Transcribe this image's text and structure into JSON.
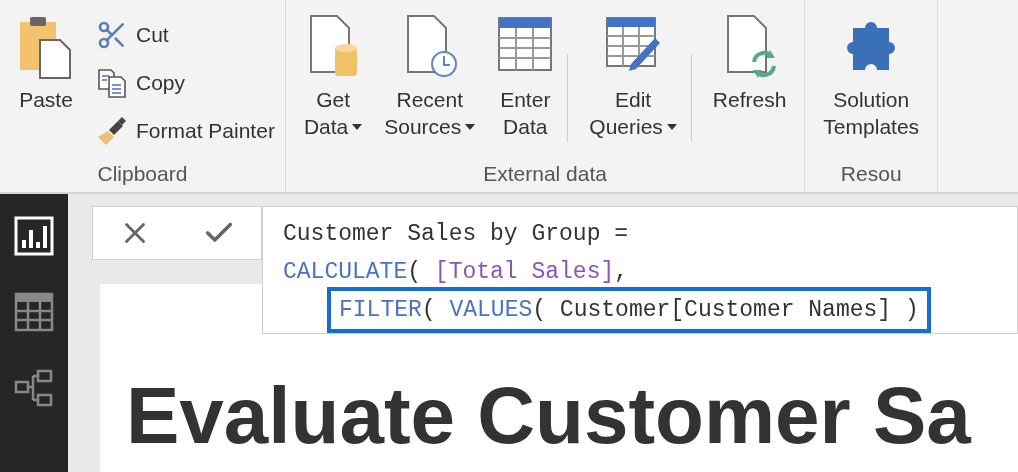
{
  "ribbon": {
    "groups": [
      {
        "label": "Clipboard",
        "large_buttons": [
          {
            "label_lines": [
              "Paste"
            ],
            "dropdown": false,
            "separator_before": false
          }
        ],
        "small_buttons": [
          {
            "label": "Cut"
          },
          {
            "label": "Copy"
          },
          {
            "label": "Format Painter"
          }
        ]
      },
      {
        "label": "External data",
        "large_buttons": [
          {
            "label_lines": [
              "Get",
              "Data"
            ],
            "dropdown": true,
            "separator_before": false
          },
          {
            "label_lines": [
              "Recent",
              "Sources"
            ],
            "dropdown": true,
            "separator_before": false
          },
          {
            "label_lines": [
              "Enter",
              "Data"
            ],
            "dropdown": false,
            "separator_before": false
          },
          {
            "label_lines": [
              "Edit",
              "Queries"
            ],
            "dropdown": true,
            "separator_before": true
          },
          {
            "label_lines": [
              "Refresh"
            ],
            "dropdown": false,
            "separator_before": true
          }
        ]
      },
      {
        "label": "Resou",
        "large_buttons": [
          {
            "label_lines": [
              "Solution",
              "Templates"
            ],
            "dropdown": false,
            "separator_before": false
          }
        ]
      }
    ]
  },
  "sidebar": {
    "views": [
      {
        "selected": true
      },
      {
        "selected": false
      },
      {
        "selected": false
      }
    ]
  },
  "formula_bar": {
    "lines": [
      {
        "boxed": false,
        "tokens": [
          {
            "kind": "plain",
            "text": "Customer Sales by Group ="
          }
        ]
      },
      {
        "boxed": false,
        "tokens": [
          {
            "kind": "keyword",
            "text": "CALCULATE"
          },
          {
            "kind": "plain",
            "text": "( "
          },
          {
            "kind": "measure",
            "text": "[Total Sales]"
          },
          {
            "kind": "plain",
            "text": ","
          }
        ]
      },
      {
        "boxed": true,
        "tokens": [
          {
            "kind": "keyword",
            "text": "FILTER"
          },
          {
            "kind": "plain",
            "text": "( "
          },
          {
            "kind": "keyword",
            "text": "VALUES"
          },
          {
            "kind": "plain",
            "text": "( Customer[Customer Names] )"
          }
        ]
      }
    ]
  },
  "canvas": {
    "title": "Evaluate Customer Sa"
  }
}
